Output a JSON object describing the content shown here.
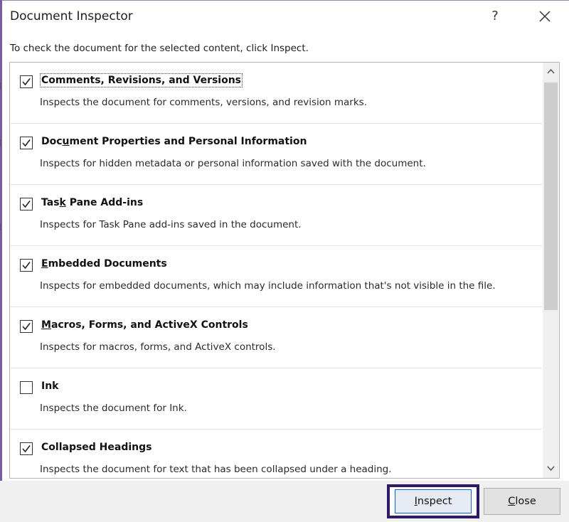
{
  "dialog": {
    "title": "Document Inspector",
    "help_label": "?",
    "instruction": "To check the document for the selected content, click Inspect."
  },
  "items": [
    {
      "name": "Comments, Revisions, and Versions",
      "description": "Inspects the document for comments, versions, and revision marks.",
      "checked": true
    },
    {
      "name_pre": "Doc",
      "name_u": "u",
      "name_post": "ment Properties and Personal Information",
      "name": "Document Properties and Personal Information",
      "description": "Inspects for hidden metadata or personal information saved with the document.",
      "checked": true
    },
    {
      "name_pre": "Tas",
      "name_u": "k",
      "name_post": " Pane Add-ins",
      "name": "Task Pane Add-ins",
      "description": "Inspects for Task Pane add-ins saved in the document.",
      "checked": true
    },
    {
      "name_pre": "",
      "name_u": "E",
      "name_post": "mbedded Documents",
      "name": "Embedded Documents",
      "description": "Inspects for embedded documents, which may include information that's not visible in the file.",
      "checked": true
    },
    {
      "name_pre": "",
      "name_u": "M",
      "name_post": "acros, Forms, and ActiveX Controls",
      "name": "Macros, Forms, and ActiveX Controls",
      "description": "Inspects for macros, forms, and ActiveX controls.",
      "checked": true
    },
    {
      "name": "Ink",
      "description": "Inspects the document for Ink.",
      "checked": false
    },
    {
      "name": "Collapsed Headings",
      "description": "Inspects the document for text that has been collapsed under a heading.",
      "checked": true
    }
  ],
  "buttons": {
    "inspect_pre": "",
    "inspect_u": "I",
    "inspect_post": "nspect",
    "inspect_label": "Inspect",
    "close_pre": "",
    "close_u": "C",
    "close_post": "lose",
    "close_label": "Close"
  },
  "colors": {
    "focus_border": "#2e1a66",
    "default_button_border": "#0a64c8",
    "scroll_thumb": "#cdcdcd"
  },
  "icons": {
    "checkmark": "check-icon",
    "close": "close-icon",
    "scroll_up": "chevron-up-icon",
    "scroll_down": "chevron-down-icon"
  }
}
